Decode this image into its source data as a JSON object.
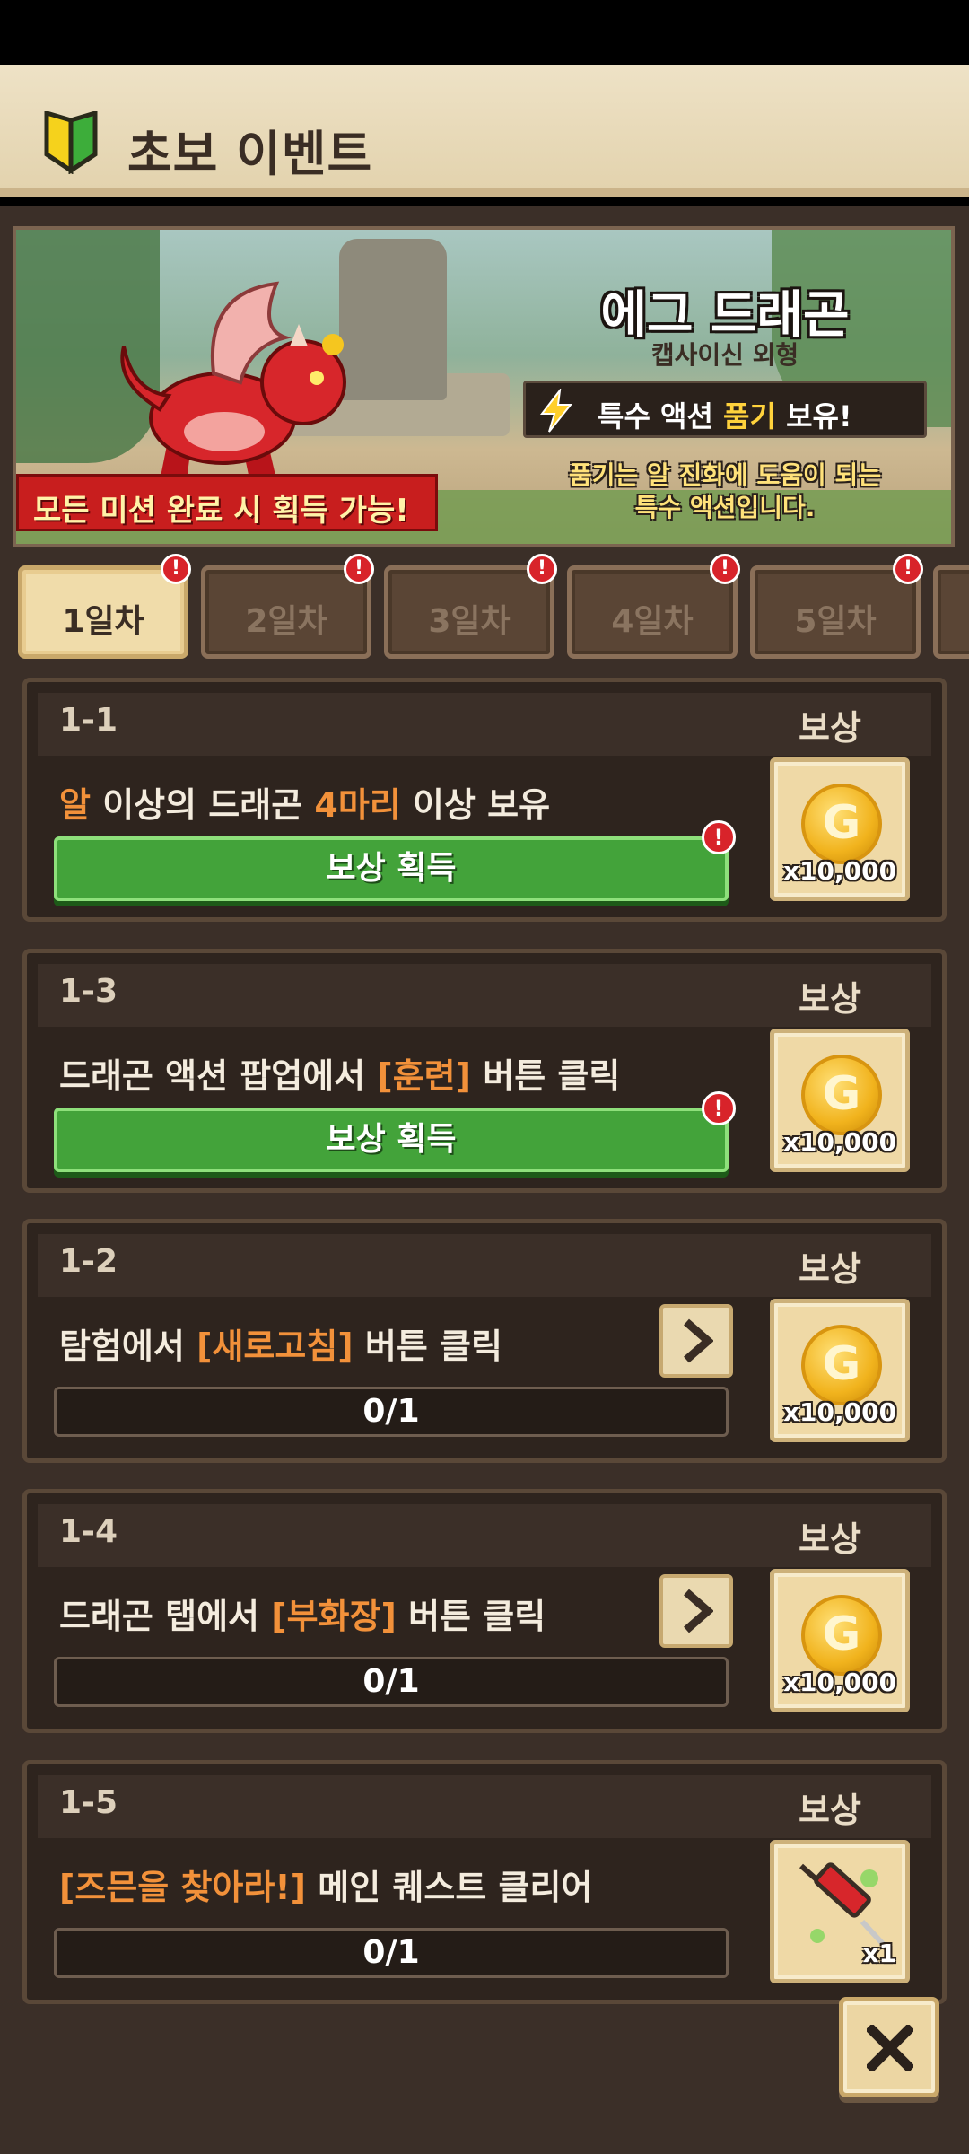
{
  "header": {
    "title": "초보 이벤트"
  },
  "banner": {
    "title": "에그 드래곤",
    "subtitle": "캡사이신 외형",
    "action_prefix": "특수 액션 ",
    "action_highlight": "품기",
    "action_suffix": " 보유!",
    "desc_line1": "품기는 알 진화에 도움이 되는",
    "desc_line2": "특수 액션입니다.",
    "ribbon": "모든 미션 완료 시 획득 가능!"
  },
  "tabs": [
    {
      "label": "1일차",
      "active": true,
      "badge": "!"
    },
    {
      "label": "2일차",
      "active": false,
      "badge": "!"
    },
    {
      "label": "3일차",
      "active": false,
      "badge": "!"
    },
    {
      "label": "4일차",
      "active": false,
      "badge": "!"
    },
    {
      "label": "5일차",
      "active": false,
      "badge": "!"
    }
  ],
  "reward_label": "보상",
  "missions": [
    {
      "code": "1-1",
      "desc_parts": [
        {
          "t": "알",
          "o": true
        },
        {
          "t": " 이상의 드래곤 ",
          "o": false
        },
        {
          "t": "4마리",
          "o": true
        },
        {
          "t": " 이상 보유",
          "o": false
        }
      ],
      "state": "claim",
      "button": "보상 획득",
      "badge": "!",
      "reward": {
        "icon": "gold-coin-icon",
        "qty": "x10,000"
      }
    },
    {
      "code": "1-3",
      "desc_parts": [
        {
          "t": "드래곤 액션 팝업에서 ",
          "o": false
        },
        {
          "t": "[훈련]",
          "o": true
        },
        {
          "t": " 버튼 클릭",
          "o": false
        }
      ],
      "state": "claim",
      "button": "보상 획득",
      "badge": "!",
      "reward": {
        "icon": "gold-coin-icon",
        "qty": "x10,000"
      }
    },
    {
      "code": "1-2",
      "desc_parts": [
        {
          "t": "탐험에서 ",
          "o": false
        },
        {
          "t": "[새로고침]",
          "o": true
        },
        {
          "t": " 버튼 클릭",
          "o": false
        }
      ],
      "state": "progress",
      "progress": "0/1",
      "reward": {
        "icon": "gold-coin-icon",
        "qty": "x10,000"
      }
    },
    {
      "code": "1-4",
      "desc_parts": [
        {
          "t": "드래곤 탭에서 ",
          "o": false
        },
        {
          "t": "[부화장]",
          "o": true
        },
        {
          "t": " 버튼 클릭",
          "o": false
        }
      ],
      "state": "progress",
      "progress": "0/1",
      "reward": {
        "icon": "gold-coin-icon",
        "qty": "x10,000"
      }
    },
    {
      "code": "1-5",
      "desc_parts": [
        {
          "t": "[즈믄을 찾아라!]",
          "o": true
        },
        {
          "t": " 메인 퀘스트 클리어",
          "o": false
        }
      ],
      "state": "progress-nogo",
      "progress": "0/1",
      "reward": {
        "icon": "syringe-icon",
        "qty": "x1"
      }
    }
  ],
  "coin_glyph": "G",
  "colors": {
    "accent_orange": "#f2913a",
    "claim_green": "#43a33a",
    "badge_red": "#d8232a"
  }
}
